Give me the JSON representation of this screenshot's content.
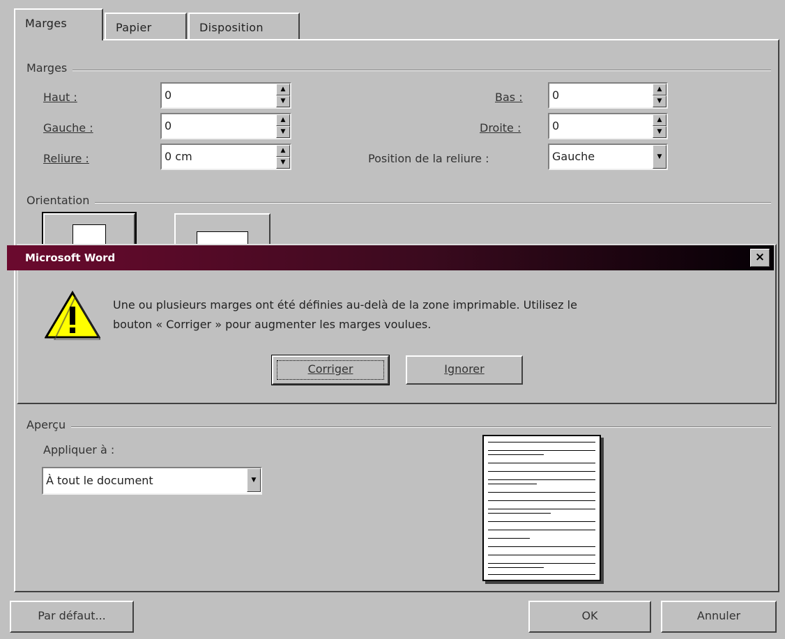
{
  "tabs": [
    {
      "label": "Marges"
    },
    {
      "label": "Papier"
    },
    {
      "label": "Disposition"
    }
  ],
  "margins": {
    "group_title": "Marges",
    "haut_label": "Haut :",
    "haut_value": "0",
    "gauche_label": "Gauche :",
    "gauche_value": "0",
    "reliure_label": "Reliure :",
    "reliure_value": "0 cm",
    "bas_label": "Bas :",
    "bas_value": "0",
    "droite_label": "Droite :",
    "droite_value": "0",
    "position_label": "Position de la reliure :",
    "position_value": "Gauche"
  },
  "orientation": {
    "group_title": "Orientation"
  },
  "alert": {
    "title": "Microsoft Word",
    "message_line1": "Une ou plusieurs marges ont été définies au-delà de la zone imprimable. Utilisez le",
    "message_line2": "bouton « Corriger » pour augmenter les marges voulues.",
    "fix_button": "Corriger",
    "ignore_button": "Ignorer",
    "close_glyph": "×",
    "icon": "warning-icon"
  },
  "apercu": {
    "group_title": "Aperçu",
    "apply_label": "Appliquer à :",
    "apply_value": "À tout le document"
  },
  "footer": {
    "default_button": "Par défaut...",
    "ok_button": "OK",
    "cancel_button": "Annuler"
  },
  "colors": {
    "face": "#c0c0c0",
    "titlebar_start": "#6b0a2e",
    "titlebar_end": "#050005",
    "warning_yellow": "#ffff00"
  }
}
